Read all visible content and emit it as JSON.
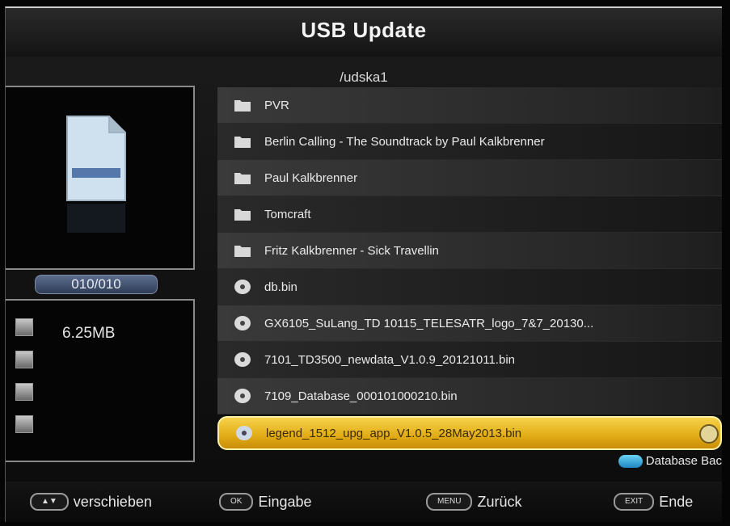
{
  "header": {
    "title": "USB Update",
    "path": "/udska1"
  },
  "left_panel": {
    "preview_icon": "file-document-icon",
    "counter": "010/010",
    "file_size": "6.25MB",
    "info_icons": [
      "info-icon-1",
      "info-icon-2",
      "info-icon-3",
      "info-icon-4"
    ]
  },
  "files": [
    {
      "name": "PVR",
      "icon": "folder-icon"
    },
    {
      "name": "Berlin Calling - The Soundtrack by Paul Kalkbrenner",
      "icon": "folder-icon"
    },
    {
      "name": "Paul Kalkbrenner",
      "icon": "folder-icon"
    },
    {
      "name": "Tomcraft",
      "icon": "folder-icon"
    },
    {
      "name": "Fritz Kalkbrenner - Sick Travellin",
      "icon": "folder-icon"
    },
    {
      "name": "db.bin",
      "icon": "disc-file-icon"
    },
    {
      "name": "GX6105_SuLang_TD 10115_TELESATR_logo_7&7_20130...",
      "icon": "disc-file-icon"
    },
    {
      "name": "7101_TD3500_newdata_V1.0.9_20121011.bin",
      "icon": "disc-file-icon"
    },
    {
      "name": "7109_Database_000101000210.bin",
      "icon": "disc-file-icon"
    },
    {
      "name": "legend_1512_upg_app_V1.0.5_28May2013.bin",
      "icon": "disc-file-icon",
      "selected": true
    }
  ],
  "hint": {
    "label": "Database Bac",
    "color": "#3aaee0"
  },
  "footer": {
    "move": {
      "key": "▲▼",
      "label": "verschieben"
    },
    "enter": {
      "key": "OK",
      "label": "Eingabe"
    },
    "back": {
      "key": "MENU",
      "label": "Zurück"
    },
    "exit": {
      "key": "EXIT",
      "label": "Ende"
    }
  },
  "colors": {
    "selected_row": "#f0c030",
    "background": "#111111"
  }
}
